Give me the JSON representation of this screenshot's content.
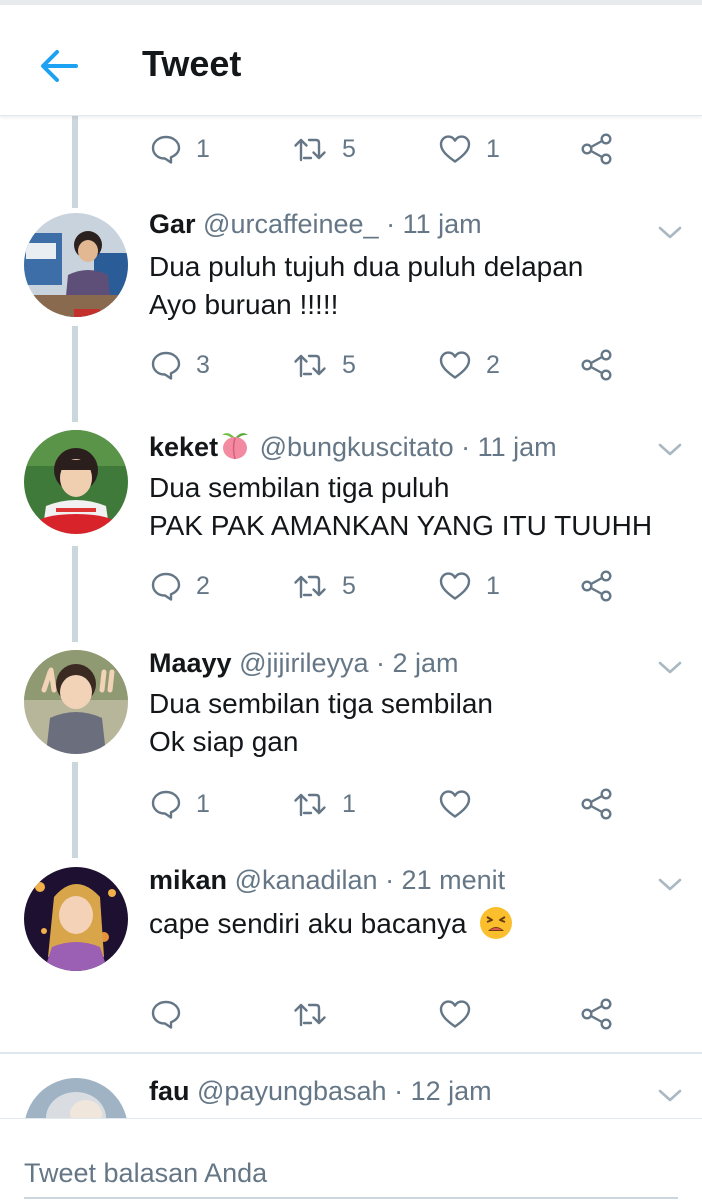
{
  "header": {
    "title": "Tweet"
  },
  "top_actions": {
    "reply_count": "1",
    "retweet_count": "5",
    "like_count": "1"
  },
  "tweets": [
    {
      "name": "Gar",
      "handle": "@urcaffeinee_ · 11 jam",
      "lines": [
        "Dua puluh tujuh dua puluh delapan",
        "Ayo buruan !!!!!"
      ],
      "reply_count": "3",
      "retweet_count": "5",
      "like_count": "2"
    },
    {
      "name": "keket",
      "handle": "@bungkuscitato · 11 jam",
      "lines": [
        "Dua sembilan tiga puluh",
        "PAK PAK AMANKAN YANG ITU TUUHH"
      ],
      "reply_count": "2",
      "retweet_count": "5",
      "like_count": "1"
    },
    {
      "name": "Maayy",
      "handle": "@jijirileyya · 2 jam",
      "lines": [
        "Dua sembilan tiga sembilan",
        "Ok siap gan"
      ],
      "reply_count": "1",
      "retweet_count": "1",
      "like_count": ""
    },
    {
      "name": "mikan",
      "handle": "@kanadilan · 21 menit",
      "lines": [
        "cape sendiri aku bacanya"
      ],
      "reply_count": "",
      "retweet_count": "",
      "like_count": ""
    },
    {
      "name": "fau",
      "handle": "@payungbasah · 12 jam"
    }
  ],
  "reply_bar": {
    "placeholder": "Tweet balasan Anda"
  },
  "icons": {
    "back": "arrow-left-icon",
    "reply": "reply-bubble-icon",
    "retweet": "retweet-icon",
    "like": "heart-icon",
    "share": "share-icon",
    "caret": "chevron-down-icon",
    "emoji": "tired-face-emoji-icon"
  },
  "colors": {
    "accent": "#1da1f2",
    "icon_gray": "#657786",
    "text": "#14171a",
    "thread_line": "#ccd6dd"
  }
}
